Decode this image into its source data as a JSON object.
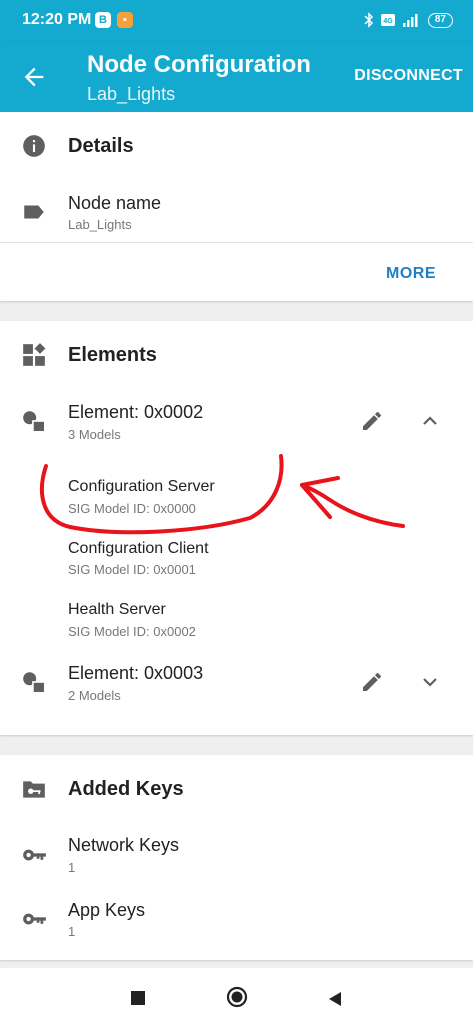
{
  "status_bar": {
    "time": "12:20 PM",
    "badge_b": "B",
    "battery": "87"
  },
  "app_bar": {
    "title": "Node Configuration",
    "subtitle": "Lab_Lights",
    "action": "DISCONNECT",
    "color": "#14a9cf"
  },
  "details": {
    "title": "Details",
    "node_name_label": "Node name",
    "node_name_value": "Lab_Lights",
    "more": "MORE"
  },
  "elements": {
    "title": "Elements",
    "items": [
      {
        "name": "Element: 0x0002",
        "count": "3 Models",
        "expanded": true,
        "models": [
          {
            "name": "Configuration Server",
            "id": "SIG Model ID: 0x0000"
          },
          {
            "name": "Configuration Client",
            "id": "SIG Model ID: 0x0001"
          },
          {
            "name": "Health Server",
            "id": "SIG Model ID: 0x0002"
          }
        ]
      },
      {
        "name": "Element: 0x0003",
        "count": "2 Models",
        "expanded": false
      }
    ]
  },
  "keys": {
    "title": "Added Keys",
    "network_label": "Network Keys",
    "network_count": "1",
    "app_label": "App Keys",
    "app_count": "1"
  },
  "icons": {
    "back": "arrow-back-icon",
    "info": "info-icon",
    "tag": "label-tag-icon",
    "elements": "widgets-icon",
    "element": "element-shapes-icon",
    "edit": "pencil-icon",
    "expand_less": "chevron-up-icon",
    "expand_more": "chevron-down-icon",
    "keys_folder": "folder-key-icon",
    "key": "key-icon"
  },
  "annotation": {
    "color": "#e8131b"
  }
}
